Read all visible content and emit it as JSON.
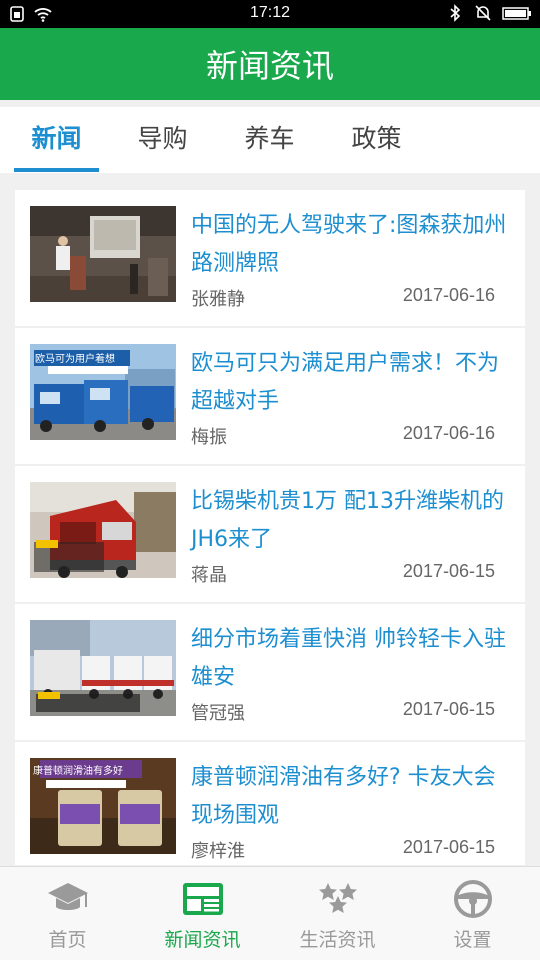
{
  "status_bar": {
    "time": "17:12",
    "icons": [
      "sim-icon",
      "wifi-icon",
      "bluetooth-icon",
      "mute-icon",
      "battery-icon"
    ]
  },
  "header": {
    "title": "新闻资讯"
  },
  "tabs": [
    {
      "label": "新闻",
      "active": true
    },
    {
      "label": "导购",
      "active": false
    },
    {
      "label": "养车",
      "active": false
    },
    {
      "label": "政策",
      "active": false
    }
  ],
  "articles": [
    {
      "title": "中国的无人驾驶来了:图森获加州路测牌照",
      "author": "张雅静",
      "date": "2017-06-16"
    },
    {
      "title": "欧马可只为满足用户需求！不为超越对手",
      "author": "梅振",
      "date": "2017-06-16",
      "thumb_caption": "欧马可为用户着想"
    },
    {
      "title": "比锡柴机贵1万 配13升潍柴机的JH6来了",
      "author": "蒋晶",
      "date": "2017-06-15"
    },
    {
      "title": "细分市场着重快消 帅铃轻卡入驻雄安",
      "author": "管冠强",
      "date": "2017-06-15"
    },
    {
      "title": "康普顿润滑油有多好? 卡友大会现场围观",
      "author": "廖梓淮",
      "date": "2017-06-15",
      "thumb_caption": "康普顿润滑油有多好"
    }
  ],
  "bottom_nav": [
    {
      "label": "首页",
      "icon": "graduation-cap-icon",
      "active": false
    },
    {
      "label": "新闻资讯",
      "icon": "news-icon",
      "active": true
    },
    {
      "label": "生活资讯",
      "icon": "stars-icon",
      "active": false
    },
    {
      "label": "设置",
      "icon": "steering-wheel-icon",
      "active": false
    }
  ],
  "colors": {
    "primary_green": "#1aa84c",
    "tab_blue": "#1d8fd0"
  }
}
